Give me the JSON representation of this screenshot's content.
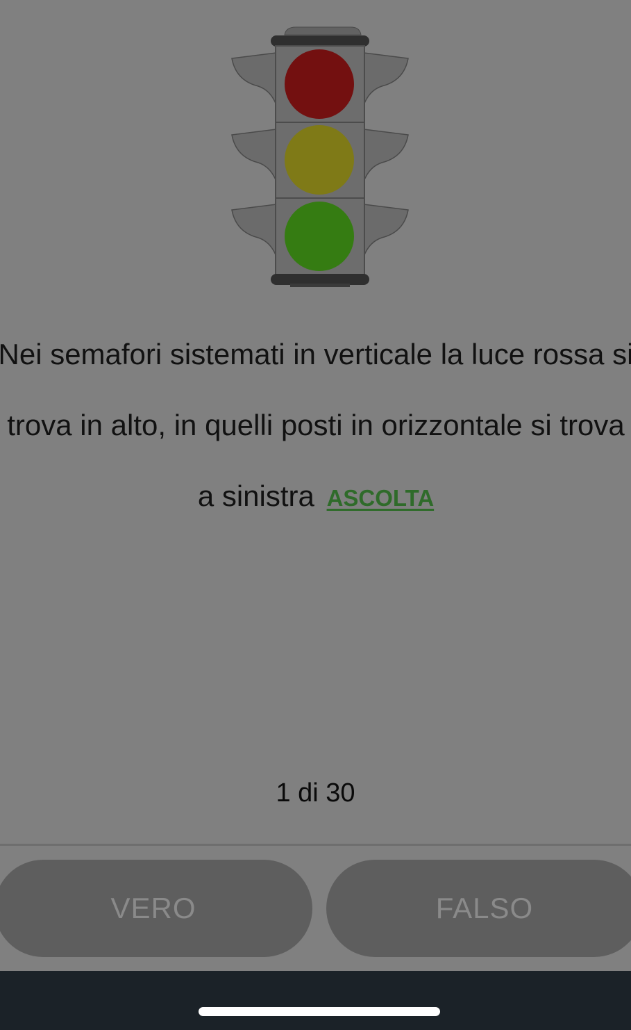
{
  "question": {
    "lines": [
      "Nei semafori sistemati in verticale la luce rossa si",
      "trova in alto, in quelli posti in orizzontale si trova",
      "a sinistra"
    ],
    "listen_label": "ASCOLTA"
  },
  "illustration": {
    "icon": "traffic-light-icon",
    "lights": [
      {
        "name": "red",
        "color": "#731010"
      },
      {
        "name": "yellow",
        "color": "#7f7a17"
      },
      {
        "name": "green",
        "color": "#357c12"
      }
    ]
  },
  "progress": {
    "label": "1 di 30"
  },
  "answers": {
    "true_label": "VERO",
    "false_label": "FALSO"
  }
}
